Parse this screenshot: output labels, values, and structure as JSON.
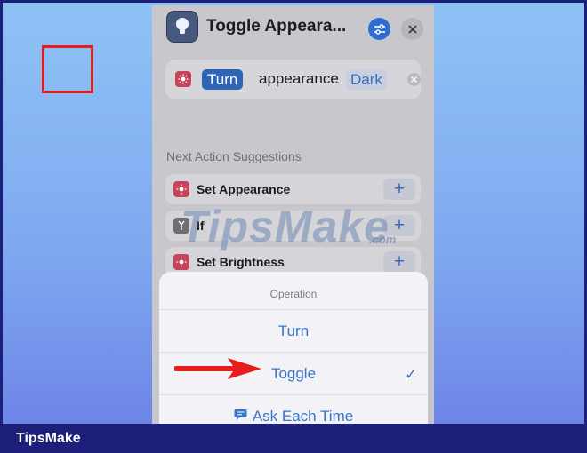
{
  "header": {
    "title": "Toggle Appeara...",
    "app_icon": "lightbulb-icon",
    "settings_icon": "sliders-icon",
    "close_icon": "close-icon"
  },
  "action": {
    "operation_chip": "Turn",
    "text": "appearance",
    "mode_chip": "Dark",
    "icon": "appearance-icon",
    "remove_icon": "remove-icon"
  },
  "suggestions": {
    "title": "Next Action Suggestions",
    "items": [
      {
        "label": "Set Appearance",
        "icon": "appearance-icon",
        "add": "+"
      },
      {
        "label": "If",
        "icon": "branch-icon",
        "add": "+"
      },
      {
        "label": "Set Brightness",
        "icon": "brightness-icon",
        "add": "+"
      }
    ]
  },
  "sheet": {
    "title": "Operation",
    "options": [
      {
        "label": "Turn",
        "selected": false
      },
      {
        "label": "Toggle",
        "selected": true
      },
      {
        "label": "Ask Each Time",
        "selected": false,
        "icon": "speech-bubble-icon"
      }
    ],
    "check": "✓"
  },
  "watermark": {
    "text": "TipsMake",
    "suffix": ".com"
  },
  "footer": {
    "brand": "TipsMake"
  },
  "colors": {
    "accent": "#3a74c7",
    "highlight": "#ea1b1b",
    "footer_bg": "#1d1f7a",
    "action_icon": "#c9445a"
  }
}
